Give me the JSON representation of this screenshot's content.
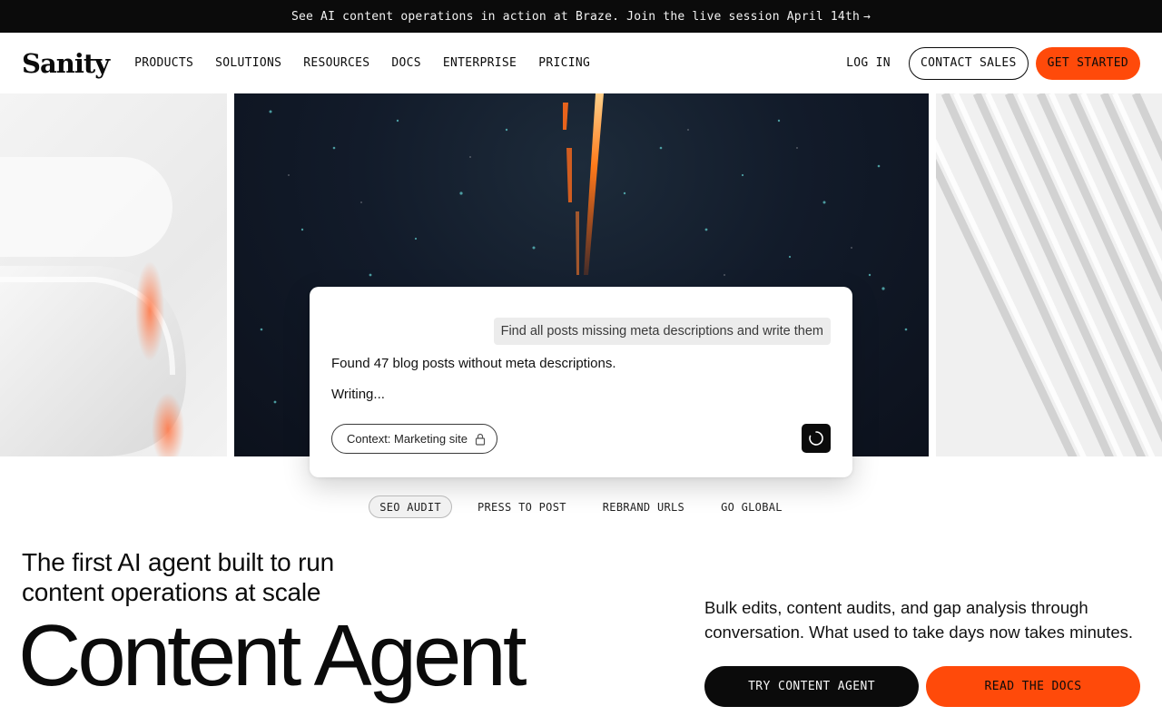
{
  "announcement": {
    "text": "See AI content operations in action at Braze. Join the live session April 14th",
    "arrow": "→"
  },
  "nav": {
    "logo": "Sanity",
    "links": [
      "PRODUCTS",
      "SOLUTIONS",
      "RESOURCES",
      "DOCS",
      "ENTERPRISE",
      "PRICING"
    ],
    "login": "LOG IN",
    "contact": "CONTACT SALES",
    "get_started": "GET STARTED"
  },
  "chat": {
    "user_message": "Find all posts missing meta descriptions and write them",
    "agent_line_1": "Found 47 blog posts without meta descriptions.",
    "agent_line_2": "Writing...",
    "context_label": "Context: Marketing site",
    "context_icon": "lock-icon",
    "action_icon": "spinner-icon"
  },
  "tabs": [
    {
      "label": "SEO AUDIT",
      "active": true
    },
    {
      "label": "PRESS TO POST",
      "active": false
    },
    {
      "label": "REBRAND URLS",
      "active": false
    },
    {
      "label": "GO GLOBAL",
      "active": false
    }
  ],
  "hero": {
    "tagline_line_1": "The first AI agent built to run",
    "tagline_line_2": "content operations at scale",
    "title": "Content Agent",
    "description": "Bulk edits, content audits, and gap analysis through conversation. What used to take days now takes minutes.",
    "cta_primary": "TRY CONTENT AGENT",
    "cta_secondary": "READ THE DOCS"
  },
  "colors": {
    "accent": "#ff4a0a",
    "dark": "#0b0b0b",
    "background": "#ffffff"
  }
}
